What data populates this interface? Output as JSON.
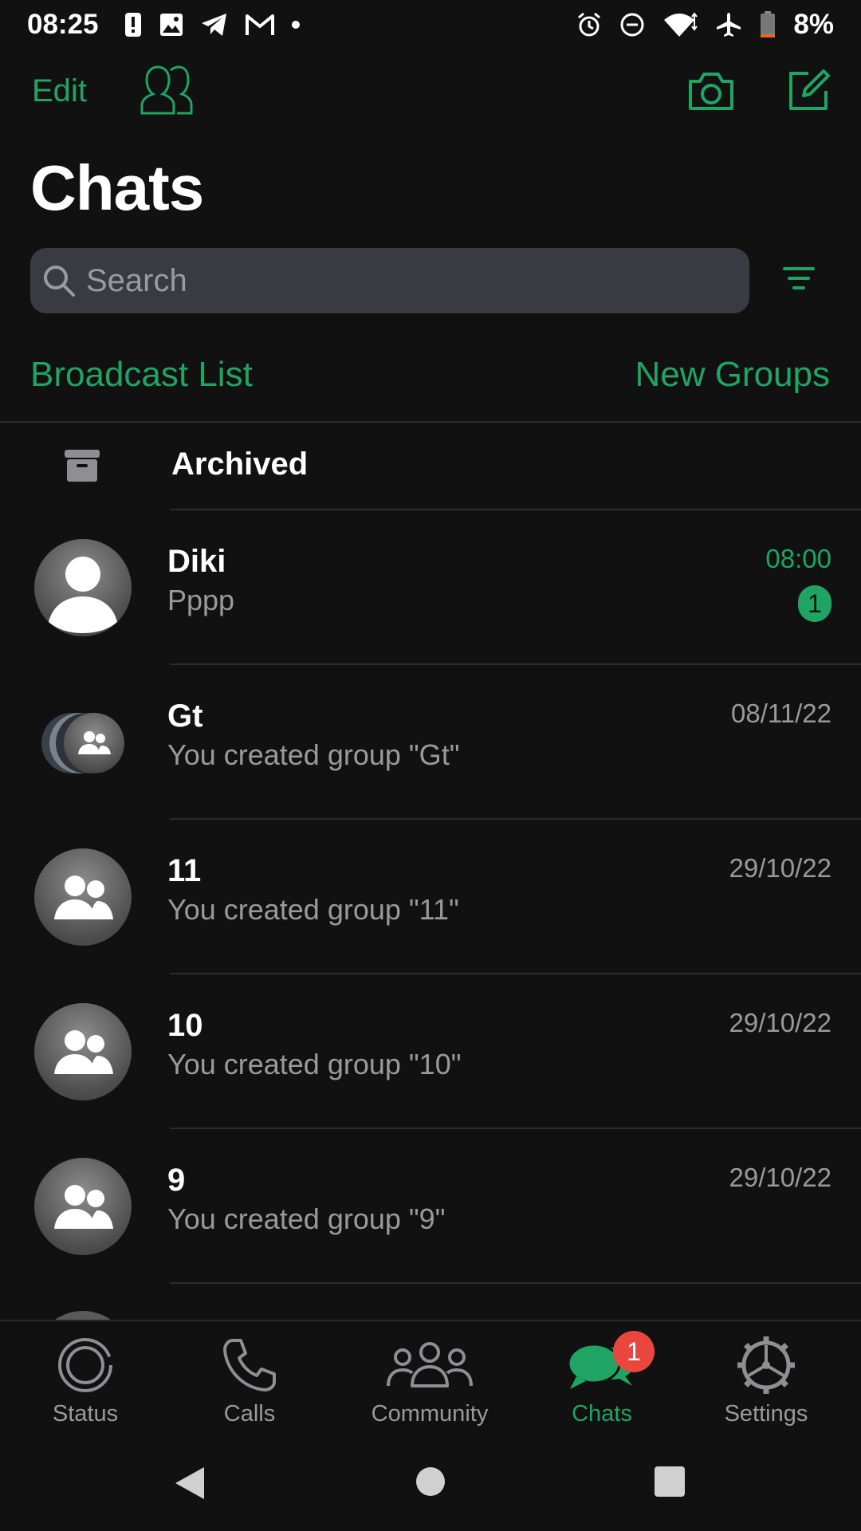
{
  "status_bar": {
    "time": "08:25",
    "battery_percent": "8%",
    "left_icons": [
      "alert-icon",
      "image-icon",
      "telegram-icon",
      "gmail-icon",
      "dot-icon"
    ],
    "right_icons": [
      "alarm-icon",
      "dnd-icon",
      "wifi-icon",
      "airplane-icon",
      "battery-icon"
    ]
  },
  "header": {
    "edit_label": "Edit",
    "title": "Chats"
  },
  "search": {
    "placeholder": "Search"
  },
  "links": {
    "broadcast": "Broadcast List",
    "new_groups": "New Groups"
  },
  "archived": {
    "label": "Archived"
  },
  "chats": [
    {
      "name": "Diki",
      "message": "Pppp",
      "time": "08:00",
      "unread": "1",
      "avatar": "person"
    },
    {
      "name": "Gt",
      "message": "You created group \"Gt\"",
      "time": "08/11/22",
      "avatar": "group-stack"
    },
    {
      "name": "11",
      "message": "You created group \"11\"",
      "time": "29/10/22",
      "avatar": "group"
    },
    {
      "name": "10",
      "message": "You created group \"10\"",
      "time": "29/10/22",
      "avatar": "group"
    },
    {
      "name": "9",
      "message": "You created group \"9\"",
      "time": "29/10/22",
      "avatar": "group"
    }
  ],
  "tabs": [
    {
      "label": "Status",
      "icon": "status-icon"
    },
    {
      "label": "Calls",
      "icon": "phone-icon"
    },
    {
      "label": "Community",
      "icon": "community-icon"
    },
    {
      "label": "Chats",
      "icon": "chats-icon",
      "active": true,
      "badge": "1"
    },
    {
      "label": "Settings",
      "icon": "gear-icon"
    }
  ],
  "colors": {
    "accent": "#1fa463",
    "background": "#111111",
    "badge_red": "#e9463e",
    "search_bg": "#3a3a42"
  }
}
